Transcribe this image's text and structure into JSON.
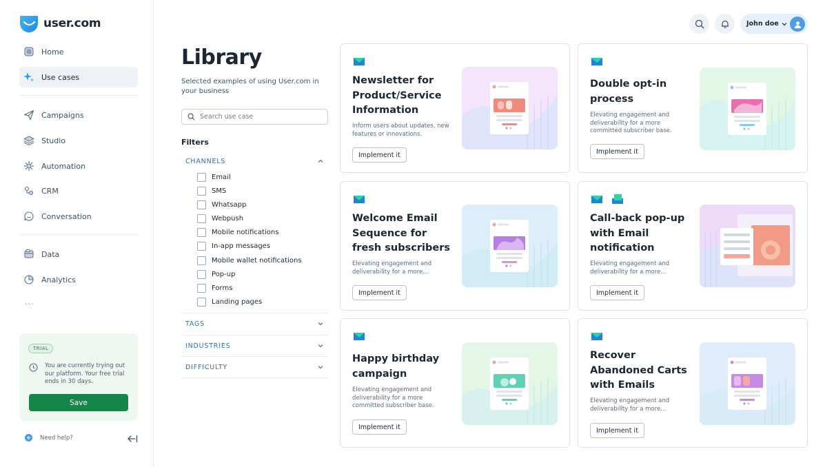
{
  "brand": {
    "name": "user.com"
  },
  "sidebar": {
    "items": [
      {
        "label": "Home",
        "icon": "home-icon"
      },
      {
        "label": "Use cases",
        "icon": "sparkle-icon",
        "active": true
      },
      {
        "label": "Campaigns",
        "icon": "paper-plane-icon"
      },
      {
        "label": "Studio",
        "icon": "layers-icon"
      },
      {
        "label": "Automation",
        "icon": "gear-network-icon"
      },
      {
        "label": "CRM",
        "icon": "contacts-icon"
      },
      {
        "label": "Conversation",
        "icon": "chat-icon"
      },
      {
        "label": "Data",
        "icon": "database-icon"
      },
      {
        "label": "Analytics",
        "icon": "pie-chart-icon"
      }
    ],
    "more": "...",
    "trial": {
      "badge": "TRIAL",
      "text": "You are currently trying out our platform. Your free trial ends in 30 days.",
      "button": "Save"
    },
    "help": "Need help?"
  },
  "header": {
    "user_name": "John doe"
  },
  "library": {
    "title": "Library",
    "subtitle": "Selected examples of using User.com in your business",
    "search_placeholder": "Search use case",
    "filters_title": "Filters",
    "channels_label": "CHANNELS",
    "channels": [
      "Email",
      "SMS",
      "Whatsapp",
      "Webpush",
      "Mobile notifications",
      "In-app messages",
      "Mobile wallet notifications",
      "Pop-up",
      "Forms",
      "Landing pages"
    ],
    "tags_label": "TAGS",
    "industries_label": "INDUSTRIES",
    "difficulty_label": "DIFFICULTY"
  },
  "cards": [
    {
      "title": "Newsletter for Product/Service Information",
      "description": "Inform users about updates, new features or innovations.",
      "button": "Implement it",
      "theme": "#efd9fb",
      "accent": "#f08a7c"
    },
    {
      "title": "Double opt-in process",
      "description": "Elevating engagement and deliverability for a more committed subscriber base.",
      "button": "Implement it",
      "theme": "#dff6e4",
      "accent": "#e56fb0"
    },
    {
      "title": "Welcome Email Sequence for fresh subscribers",
      "description": "Elevating engagement and deliverability for a more...",
      "button": "Implement it",
      "theme": "#d9ecfb",
      "accent": "#b67fe3"
    },
    {
      "title": "Call-back pop-up with Email notification",
      "description": "Elevating engagement and deliverability for a more...",
      "button": "Implement it",
      "theme": "#f1dcf7",
      "accent": "#f39a86"
    },
    {
      "title": "Happy birthday campaign",
      "description": "Elevating engagement and deliverability for a more committed subscriber base.",
      "button": "Implement it",
      "theme": "#e1f7e5",
      "accent": "#5fd2b6"
    },
    {
      "title": "Recover Abandoned Carts with Emails",
      "description": "Elevating engagement and deliverability for a more...",
      "button": "Implement it",
      "theme": "#ddecfb",
      "accent": "#c58be0"
    }
  ]
}
